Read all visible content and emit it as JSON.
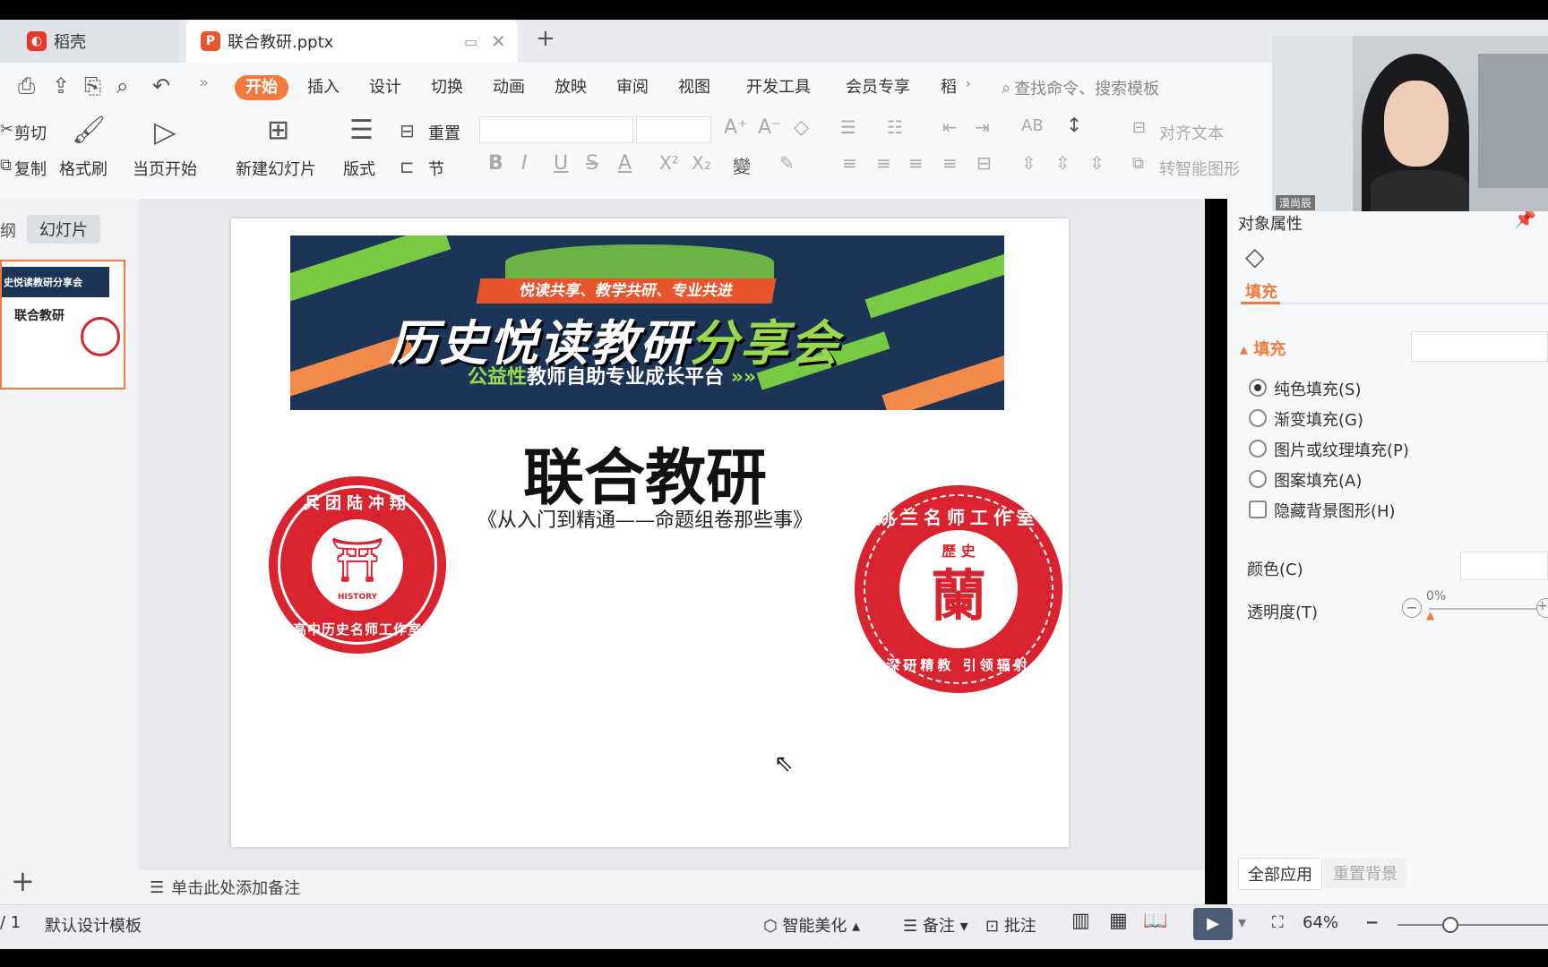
{
  "tabs": [
    {
      "label": "稻壳"
    },
    {
      "label": "联合教研.pptx"
    }
  ],
  "menu": {
    "items": [
      "开始",
      "插入",
      "设计",
      "切换",
      "动画",
      "放映",
      "审阅",
      "视图",
      "开发工具",
      "会员专享",
      "稻"
    ],
    "search_placeholder": "查找命令、搜索模板"
  },
  "ribbon": {
    "cut": "剪切",
    "copy": "复制",
    "format_painter": "格式刷",
    "play_from_current": "当页开始",
    "new_slide": "新建幻灯片",
    "layout": "版式",
    "reset": "重置",
    "section": "节",
    "align_text": "对齐文本",
    "smart_shape": "转智能图形"
  },
  "leftpane": {
    "tab_outline": "纲",
    "tab_slides": "幻灯片",
    "thumb_title": "联合教研",
    "thumb_banner": "史悦读教研分享会"
  },
  "slide": {
    "banner_top": "悦读共享、教学共研、专业共进",
    "banner_title_main": "历史悦读教研",
    "banner_title_accent": "分享会",
    "banner_sub_accent": "公益性",
    "banner_sub": "教师自助专业成长平台",
    "title": "联合教研",
    "subtitle": "《从入门到精通——命题组卷那些事》",
    "seal_left_top": "兵团陆冲翔",
    "seal_left_bottom": "高中历史名师工作室",
    "seal_left_en": "HISTORY",
    "seal_right_top": "姚兰名师工作室",
    "seal_right_center": "歷 史",
    "seal_right_bottom": "深研精教 引领辐射"
  },
  "notes_placeholder": "单击此处添加备注",
  "rightpane": {
    "header": "对象属性",
    "tab_fill": "填充",
    "section_fill": "填充",
    "options": [
      "纯色填充(S)",
      "渐变填充(G)",
      "图片或纹理填充(P)",
      "图案填充(A)"
    ],
    "hide_bg": "隐藏背景图形(H)",
    "color_label": "颜色(C)",
    "transparency_label": "透明度(T)",
    "transparency_value": "0%",
    "apply_all": "全部应用",
    "reset_bg": "重置背景"
  },
  "statusbar": {
    "page": "/ 1",
    "template": "默认设计模板",
    "beautify": "智能美化",
    "notes": "备注",
    "comments": "批注",
    "zoom": "64%"
  },
  "webcam": {
    "name": "漠尚辰"
  },
  "colors": {
    "accent": "#f27a3d",
    "seal_red": "#d9232e",
    "banner_bg": "#1c3556",
    "banner_green": "#7ac943"
  }
}
